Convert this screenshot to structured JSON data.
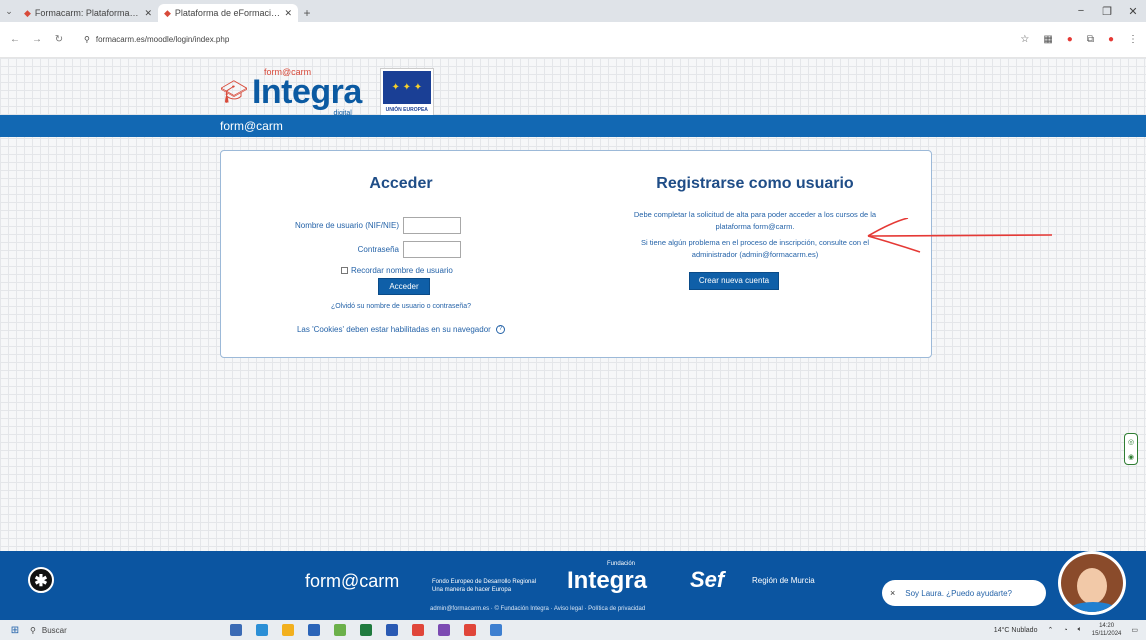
{
  "browser": {
    "tabs": [
      {
        "title": "Formacarm: Plataforma de form",
        "active": false
      },
      {
        "title": "Plataforma de eFormación Inte",
        "active": true
      }
    ],
    "url": "formacarm.es/moodle/login/index.php",
    "window_controls": [
      "−",
      "❐",
      "✕"
    ]
  },
  "header": {
    "logo_top": "form@carm",
    "logo_word": "Integra",
    "logo_sub": "_digital",
    "eu_label": "UNIÓN EUROPEA",
    "brandbar": "form@carm"
  },
  "login": {
    "title": "Acceder",
    "username_label": "Nombre de usuario (NIF/NIE)",
    "password_label": "Contraseña",
    "remember_label": "Recordar nombre de usuario",
    "login_button": "Acceder",
    "forgot_link": "¿Olvidó su nombre de usuario o contraseña?",
    "cookies_text": "Las 'Cookies' deben estar habilitadas en su navegador",
    "help_icon": "?"
  },
  "register": {
    "title": "Registrarse como usuario",
    "text1": "Debe completar la solicitud de alta para poder acceder a los cursos de la plataforma form@carm.",
    "text2": "Si tiene algún problema en el proceso de inscripción, consulte con el administrador (admin@formacarm.es)",
    "button": "Crear nueva cuenta"
  },
  "footer": {
    "accessibility_icon": "✱",
    "formacarm": "form@carm",
    "feder_line1": "Fondo Europeo de Desarrollo Regional",
    "feder_line2": "Una manera de hacer Europa",
    "integra": "Integra",
    "integra_small": "Fundación",
    "sef": "Sef",
    "region": "Región de Murcia",
    "links": "admin@formacarm.es · © Fundación Integra · Aviso legal · Política de privacidad",
    "chat_text": "Soy Laura. ¿Puedo ayudarte?",
    "chat_close": "×"
  },
  "taskbar": {
    "search": "Buscar",
    "weather": "14°C Nublado",
    "time": "14:20",
    "date": "15/11/2024"
  },
  "colors": {
    "brand_blue": "#1268b3",
    "footer_blue": "#0b55a1",
    "accent_red": "#d84a3a"
  }
}
